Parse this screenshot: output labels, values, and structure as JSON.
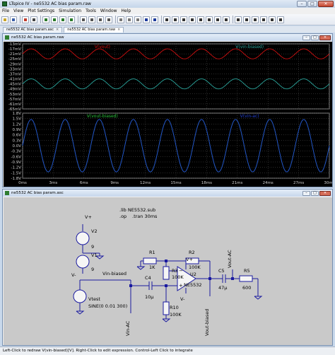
{
  "window": {
    "title": "LTspice IV - ne5532 AC bias param.raw"
  },
  "menu": [
    "File",
    "View",
    "Plot Settings",
    "Simulation",
    "Tools",
    "Window",
    "Help"
  ],
  "tabs": [
    {
      "label": "ne5532 AC bias param.asc",
      "active": false
    },
    {
      "label": "ne5532 AC bias param.raw",
      "active": true
    }
  ],
  "waveform_window": {
    "title": "ne5532 AC bias param.raw",
    "pane_top": {
      "traces": [
        {
          "label": "V(vout)",
          "color": "#d01010"
        },
        {
          "label": "V(vin-biased)",
          "color": "#2aa59c"
        }
      ],
      "y_ticks": [
        "-13mV",
        "-17mV",
        "-21mV",
        "-25mV",
        "-29mV",
        "-33mV",
        "-37mV",
        "-41mV",
        "-45mV",
        "-49mV",
        "-53mV",
        "-57mV",
        "-61mV",
        "-65mV"
      ]
    },
    "pane_bottom": {
      "traces": [
        {
          "label": "V(vout-biased)",
          "color": "#29c23a"
        },
        {
          "label": "V(vin-ac)",
          "color": "#2140d4"
        }
      ],
      "y_ticks": [
        "1.8V",
        "1.5V",
        "1.2V",
        "0.9V",
        "0.6V",
        "0.3V",
        "0.0V",
        "-0.3V",
        "-0.6V",
        "-0.9V",
        "-1.2V",
        "-1.5V",
        "-1.8V"
      ]
    },
    "x_ticks": [
      "0ms",
      "3ms",
      "6ms",
      "9ms",
      "12ms",
      "15ms",
      "18ms",
      "21ms",
      "24ms",
      "27ms",
      "30ms"
    ]
  },
  "chart_data": {
    "type": "line",
    "x_unit": "ms",
    "xlim": [
      0,
      30
    ],
    "panes": [
      {
        "ylim": [
          -65,
          -13
        ],
        "y_unit": "mV",
        "series": [
          {
            "name": "V(vout)",
            "kind": "sine",
            "offset": -21,
            "amplitude": 4,
            "frequency_hz": 300
          },
          {
            "name": "V(vin-biased)",
            "kind": "sine",
            "offset": -45,
            "amplitude": 4,
            "frequency_hz": 300
          }
        ]
      },
      {
        "ylim": [
          -1.8,
          1.8
        ],
        "y_unit": "V",
        "series": [
          {
            "name": "V(vout-biased)",
            "kind": "sine",
            "offset": 0,
            "amplitude": 1.45,
            "frequency_hz": 300
          },
          {
            "name": "V(vin-ac)",
            "kind": "sine",
            "offset": 0,
            "amplitude": 1.45,
            "frequency_hz": 300
          }
        ]
      }
    ]
  },
  "schematic_window": {
    "title": "ne5532 AC bias param.asc",
    "directives": [
      ".lib NE5532.sub",
      ".op",
      ".tran 30ms"
    ],
    "sources": {
      "v2": {
        "name": "V2",
        "value": "9"
      },
      "v1": {
        "name": "V1",
        "value": "9"
      },
      "vtest": {
        "name": "Vtest",
        "value": "SINE(0 0.01 300)"
      }
    },
    "rails": {
      "pos": "V+",
      "neg": "V-"
    },
    "components": {
      "r1": {
        "name": "R1",
        "value": "1K"
      },
      "r2": {
        "name": "R2",
        "value": "100K"
      },
      "r3": {
        "name": "R3",
        "value": "100K"
      },
      "r5": {
        "name": "R5",
        "value": "600"
      },
      "r10": {
        "name": "R10",
        "value": "100K"
      },
      "c4": {
        "name": "C4",
        "value": "10µ"
      },
      "c5": {
        "name": "C5",
        "value": "47µ"
      },
      "u2": {
        "name": "U2",
        "value": "NE5532"
      }
    },
    "nets": {
      "vin_biased": "Vin-biased",
      "vin_ac": "Vin-AC",
      "vout_biased": "Vout-biased",
      "vout_ac": "Vout-AC"
    }
  },
  "status_bar": {
    "text": "Left-Click to redraw V(vin-biased)[V].  Right-Click to edit expression.  Control-Left Click to integrate"
  }
}
